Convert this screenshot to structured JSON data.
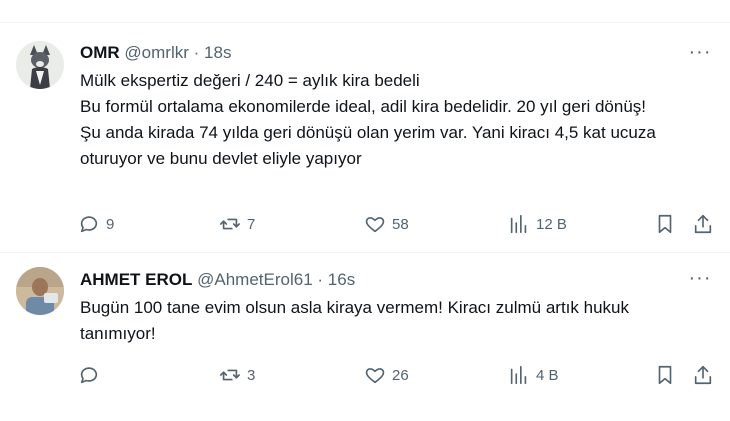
{
  "tweets": [
    {
      "name": "OMR",
      "handle": "@omrlkr",
      "separator": "·",
      "time": "18s",
      "lines": [
        "Mülk ekspertiz değeri / 240 = aylık kira bedeli",
        "Bu formül ortalama ekonomilerde ideal, adil kira bedelidir. 20 yıl geri dönüş!",
        "Şu anda kirada 74 yılda geri dönüşü olan yerim var. Yani kiracı  4,5 kat ucuza oturuyor ve bunu devlet eliyle yapıyor"
      ],
      "replies": "9",
      "retweets": "7",
      "likes": "58",
      "views": "12 B"
    },
    {
      "name": "AHMET EROL",
      "handle": "@AhmetErol61",
      "separator": "·",
      "time": "16s",
      "lines": [
        "Bugün 100 tane evim olsun asla kiraya vermem! Kiracı zulmü artık hukuk tanımıyor!"
      ],
      "replies": "",
      "retweets": "3",
      "likes": "26",
      "views": "4 B"
    }
  ],
  "icons": {
    "reply": "reply-icon",
    "retweet": "retweet-icon",
    "like": "heart-icon",
    "views": "views-chart-icon",
    "bookmark": "bookmark-icon",
    "share": "share-icon",
    "more": "more-dots-icon"
  },
  "colors": {
    "text": "#0f1419",
    "secondary": "#536471",
    "divider": "#eff3f4"
  }
}
